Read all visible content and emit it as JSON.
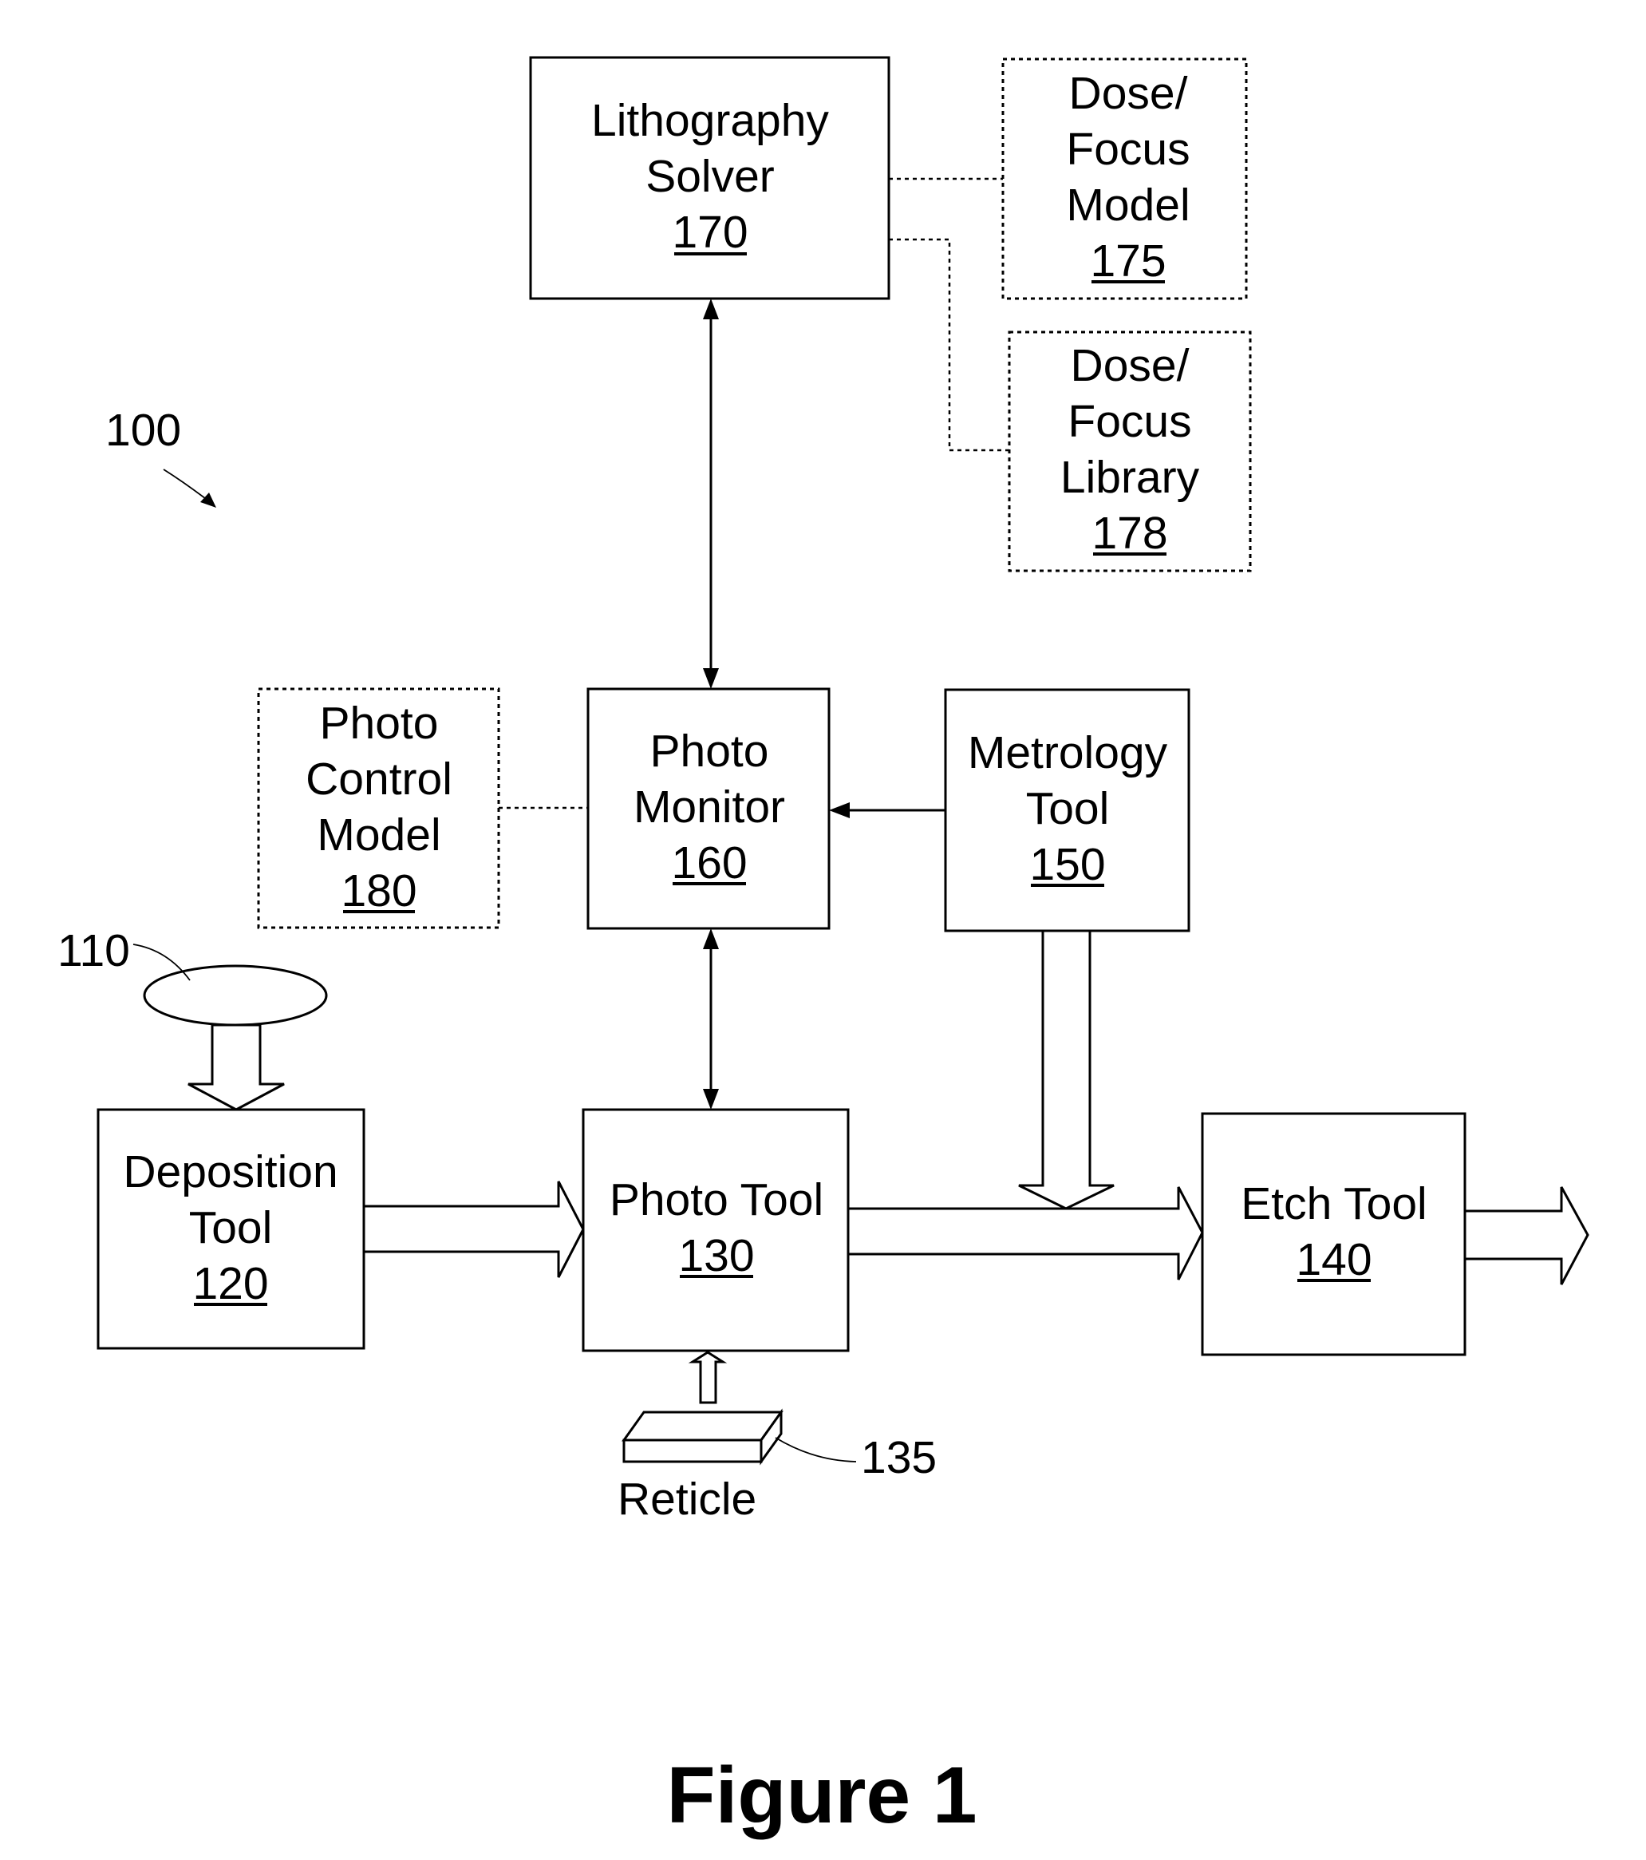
{
  "figure_caption": "Figure 1",
  "system_ref": "100",
  "wafer_ref": "110",
  "reticle": {
    "label": "Reticle",
    "ref": "135"
  },
  "blocks": {
    "lithography_solver": {
      "lines": [
        "Lithography",
        "Solver"
      ],
      "ref": "170",
      "style": "solid"
    },
    "dose_focus_model": {
      "lines": [
        "Dose/",
        "Focus",
        "Model"
      ],
      "ref": "175",
      "style": "dotted"
    },
    "dose_focus_library": {
      "lines": [
        "Dose/",
        "Focus",
        "Library"
      ],
      "ref": "178",
      "style": "dotted"
    },
    "photo_control_model": {
      "lines": [
        "Photo",
        "Control",
        "Model"
      ],
      "ref": "180",
      "style": "dotted"
    },
    "photo_monitor": {
      "lines": [
        "Photo",
        "Monitor"
      ],
      "ref": "160",
      "style": "solid"
    },
    "metrology_tool": {
      "lines": [
        "Metrology",
        "Tool"
      ],
      "ref": "150",
      "style": "solid"
    },
    "deposition_tool": {
      "lines": [
        "Deposition",
        "Tool"
      ],
      "ref": "120",
      "style": "solid"
    },
    "photo_tool": {
      "lines": [
        "Photo Tool"
      ],
      "ref": "130",
      "style": "solid"
    },
    "etch_tool": {
      "lines": [
        "Etch Tool"
      ],
      "ref": "140",
      "style": "solid"
    }
  },
  "connections": [
    {
      "from": "lithography_solver",
      "to": "dose_focus_model",
      "type": "dotted-line"
    },
    {
      "from": "lithography_solver",
      "to": "dose_focus_library",
      "type": "dotted-line"
    },
    {
      "from": "lithography_solver",
      "to": "photo_monitor",
      "type": "bidirectional-arrow"
    },
    {
      "from": "photo_control_model",
      "to": "photo_monitor",
      "type": "dotted-line"
    },
    {
      "from": "metrology_tool",
      "to": "photo_monitor",
      "type": "arrow"
    },
    {
      "from": "photo_monitor",
      "to": "photo_tool",
      "type": "bidirectional-arrow"
    },
    {
      "from": "wafer",
      "to": "deposition_tool",
      "type": "hollow-arrow"
    },
    {
      "from": "deposition_tool",
      "to": "photo_tool",
      "type": "hollow-arrow"
    },
    {
      "from": "reticle",
      "to": "photo_tool",
      "type": "hollow-arrow"
    },
    {
      "from": "photo_tool",
      "to": "etch_tool",
      "type": "hollow-arrow"
    },
    {
      "from": "metrology_tool",
      "to": "photo_tool_etch_flow",
      "type": "hollow-arrow"
    },
    {
      "from": "etch_tool",
      "to": "output",
      "type": "hollow-arrow"
    }
  ]
}
